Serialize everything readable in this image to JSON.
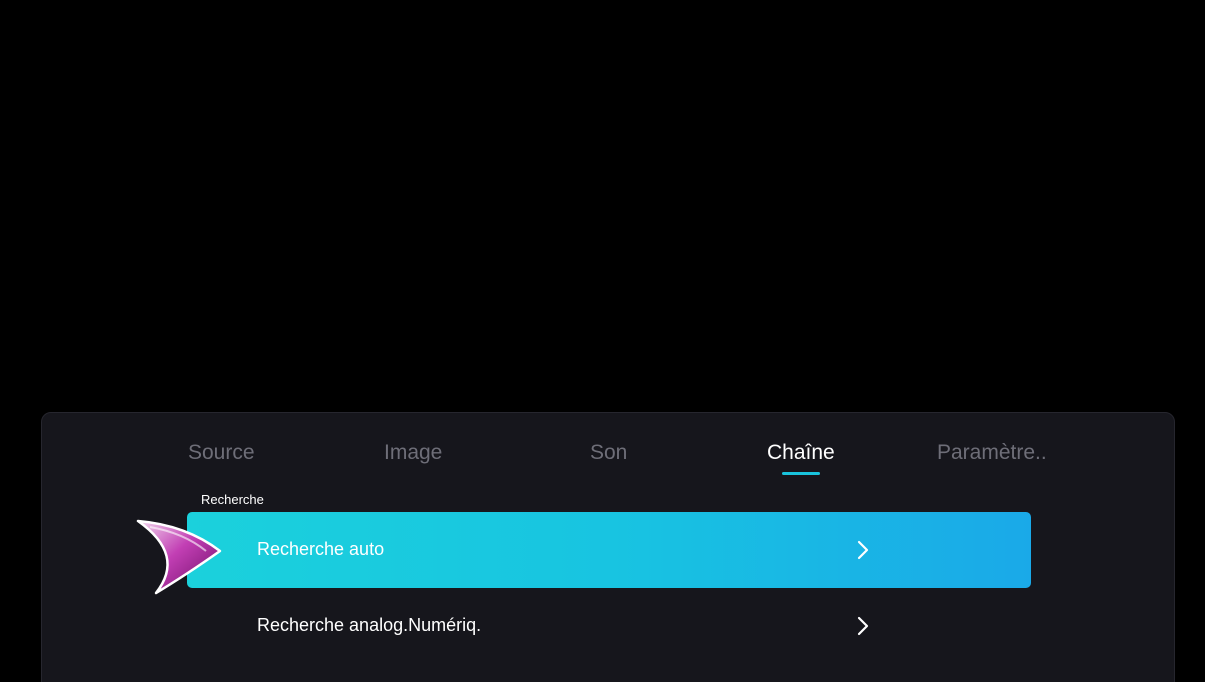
{
  "menu": {
    "tabs": [
      {
        "label": "Source",
        "active": false
      },
      {
        "label": "Image",
        "active": false
      },
      {
        "label": "Son",
        "active": false
      },
      {
        "label": "Chaîne",
        "active": true
      },
      {
        "label": "Paramètre..",
        "active": false
      }
    ],
    "section_label": "Recherche",
    "items": [
      {
        "label": "Recherche auto",
        "selected": true,
        "icon": "chevron-right-icon"
      },
      {
        "label": "Recherche analog.Numériq.",
        "selected": false,
        "icon": "chevron-right-icon"
      }
    ]
  },
  "colors": {
    "background": "#000000",
    "panel": "#16161c",
    "accent": "#19c3dc",
    "inactive_tab": "#6e6e78",
    "pointer": "#b0179e"
  }
}
